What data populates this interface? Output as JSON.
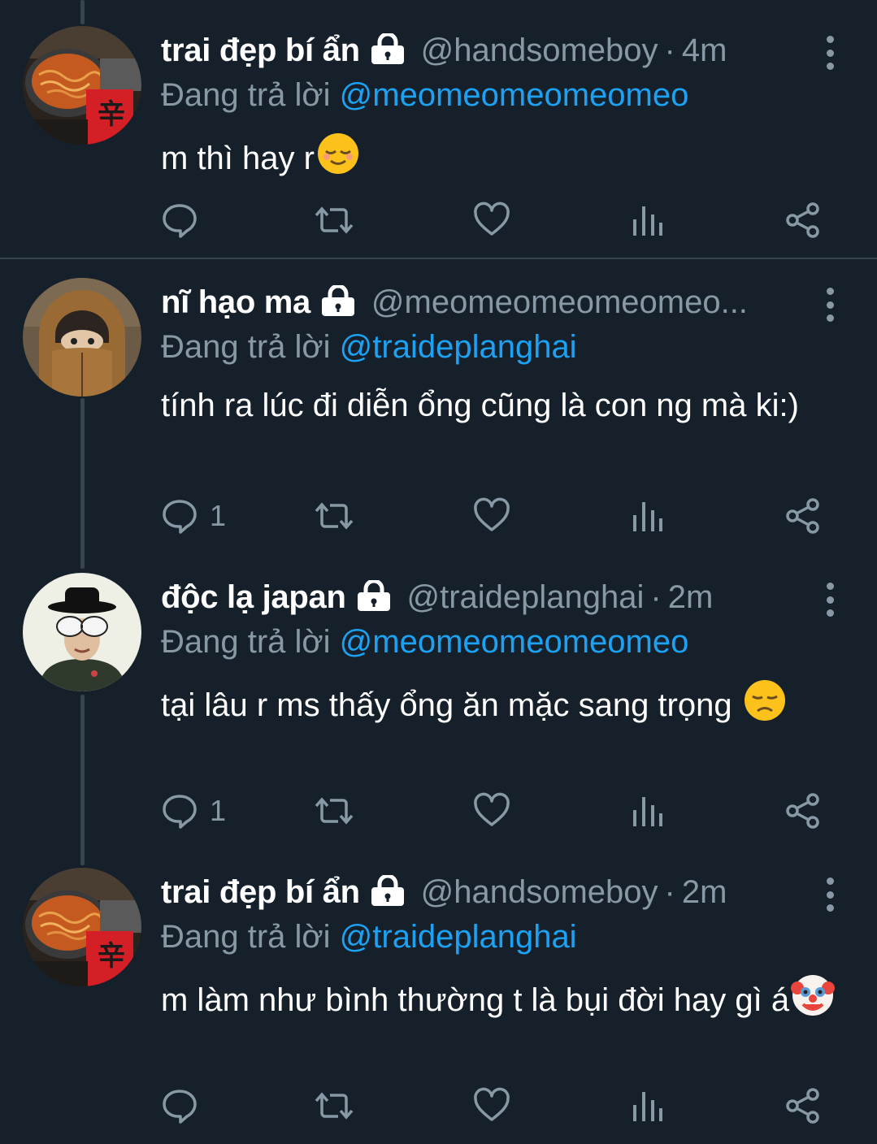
{
  "tweets": [
    {
      "name": "trai đẹp bí ẩn",
      "handle": "@handsomeboy",
      "dot": "·",
      "time": "4m",
      "replying_prefix": "Đang trả lời ",
      "replying_to": "@meomeomeomeomeo",
      "text": "m thì hay r",
      "emoji": "relieved-face",
      "reply_count": "",
      "avatar": "ramen-pot"
    },
    {
      "name": "nĩ hạo ma",
      "handle": "@meomeomeomeomeo...",
      "dot": "",
      "time": "",
      "replying_prefix": "Đang trả lời ",
      "replying_to": "@traideplanghai",
      "text": "tính ra lúc đi diễn ổng cũng là con ng mà ki:)",
      "emoji": "",
      "reply_count": "1",
      "avatar": "hooded-person"
    },
    {
      "name": "độc lạ japan",
      "handle": "@traideplanghai",
      "dot": "·",
      "time": "2m",
      "replying_prefix": "Đang trả lời ",
      "replying_to": "@meomeomeomeomeo",
      "text": "tại lâu r ms thấy ổng ăn mặc sang trọng",
      "emoji": "disappointed-face",
      "reply_count": "1",
      "avatar": "hat-sunglasses-person"
    },
    {
      "name": "trai đẹp bí ẩn",
      "handle": "@handsomeboy",
      "dot": "·",
      "time": "2m",
      "replying_prefix": "Đang trả lời ",
      "replying_to": "@traideplanghai",
      "text": "m làm như bình thường t là bụi đời hay gì á",
      "emoji": "clown-face",
      "reply_count": "",
      "avatar": "ramen-pot"
    }
  ],
  "icons": {
    "lock": "lock-icon",
    "more": "more-vertical-icon",
    "reply": "reply-icon",
    "retweet": "retweet-icon",
    "like": "heart-icon",
    "analytics": "analytics-icon",
    "share": "share-icon"
  },
  "colors": {
    "background": "#15202b",
    "text": "#ffffff",
    "muted": "#8899a6",
    "mention": "#1da1f2",
    "divider": "#38444d"
  }
}
